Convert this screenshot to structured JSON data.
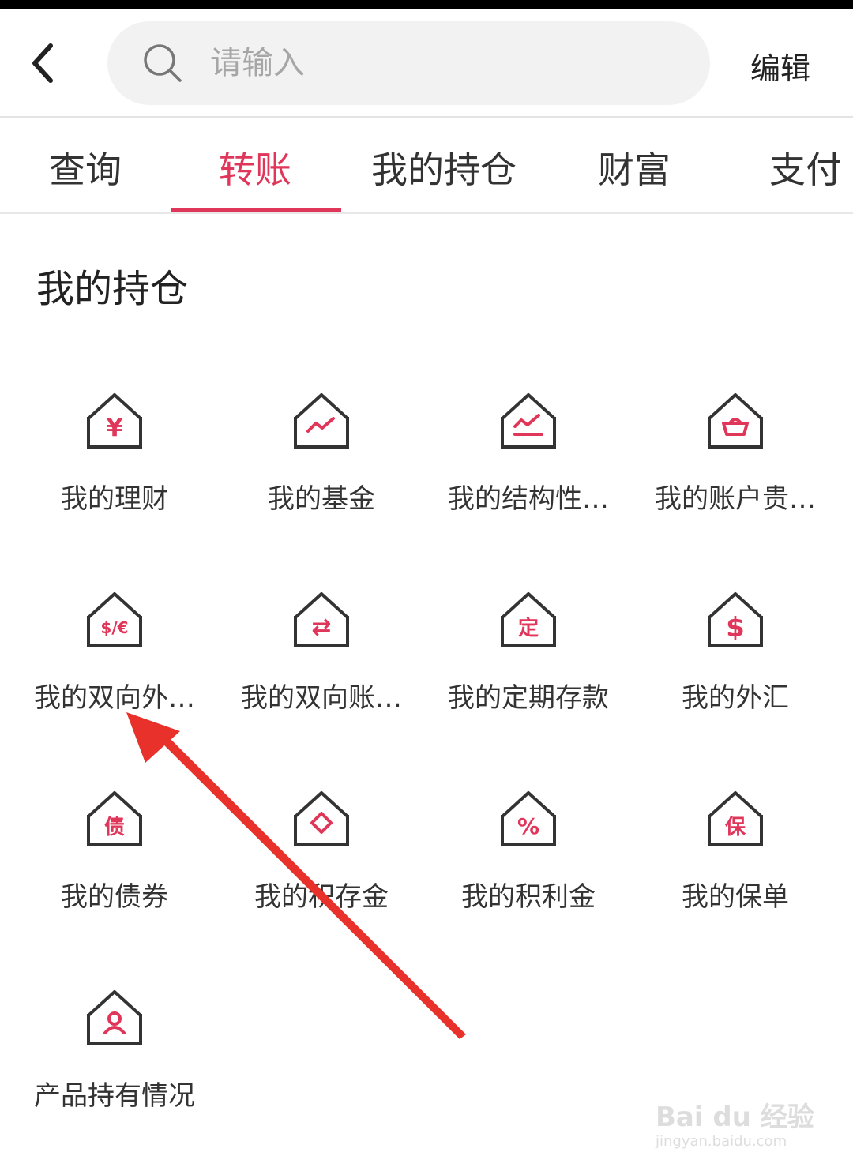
{
  "header": {
    "search_placeholder": "请输入",
    "edit_label": "编辑"
  },
  "tabs": [
    {
      "label": "查询",
      "active": false
    },
    {
      "label": "转账",
      "active": true
    },
    {
      "label": "我的持仓",
      "active": false
    },
    {
      "label": "财富",
      "active": false
    },
    {
      "label": "支付",
      "active": false
    }
  ],
  "section": {
    "title": "我的持仓"
  },
  "items": [
    {
      "label": "我的理财",
      "glyph": "¥",
      "icon": "house-yuan-icon"
    },
    {
      "label": "我的基金",
      "glyph": "",
      "icon": "house-trend-icon"
    },
    {
      "label": "我的结构性…",
      "glyph": "",
      "icon": "house-chart-icon"
    },
    {
      "label": "我的账户贵…",
      "glyph": "",
      "icon": "house-basket-icon"
    },
    {
      "label": "我的双向外…",
      "glyph": "$/€",
      "icon": "house-currency-exchange-icon"
    },
    {
      "label": "我的双向账…",
      "glyph": "⇄",
      "icon": "house-transfer-icon"
    },
    {
      "label": "我的定期存款",
      "glyph": "定",
      "icon": "house-fixed-deposit-icon"
    },
    {
      "label": "我的外汇",
      "glyph": "$",
      "icon": "house-dollar-icon"
    },
    {
      "label": "我的债券",
      "glyph": "债",
      "icon": "house-bond-icon"
    },
    {
      "label": "我的积存金",
      "glyph": "",
      "icon": "house-diamond-icon"
    },
    {
      "label": "我的积利金",
      "glyph": "%",
      "icon": "house-percent-icon"
    },
    {
      "label": "我的保单",
      "glyph": "保",
      "icon": "house-insurance-icon"
    },
    {
      "label": "产品持有情况",
      "glyph": "",
      "icon": "house-person-icon"
    }
  ],
  "watermark": {
    "text": "Bai du 经验",
    "sub": "jingyan.baidu.com"
  },
  "colors": {
    "accent": "#e0365a",
    "arrow": "#e8312a"
  }
}
